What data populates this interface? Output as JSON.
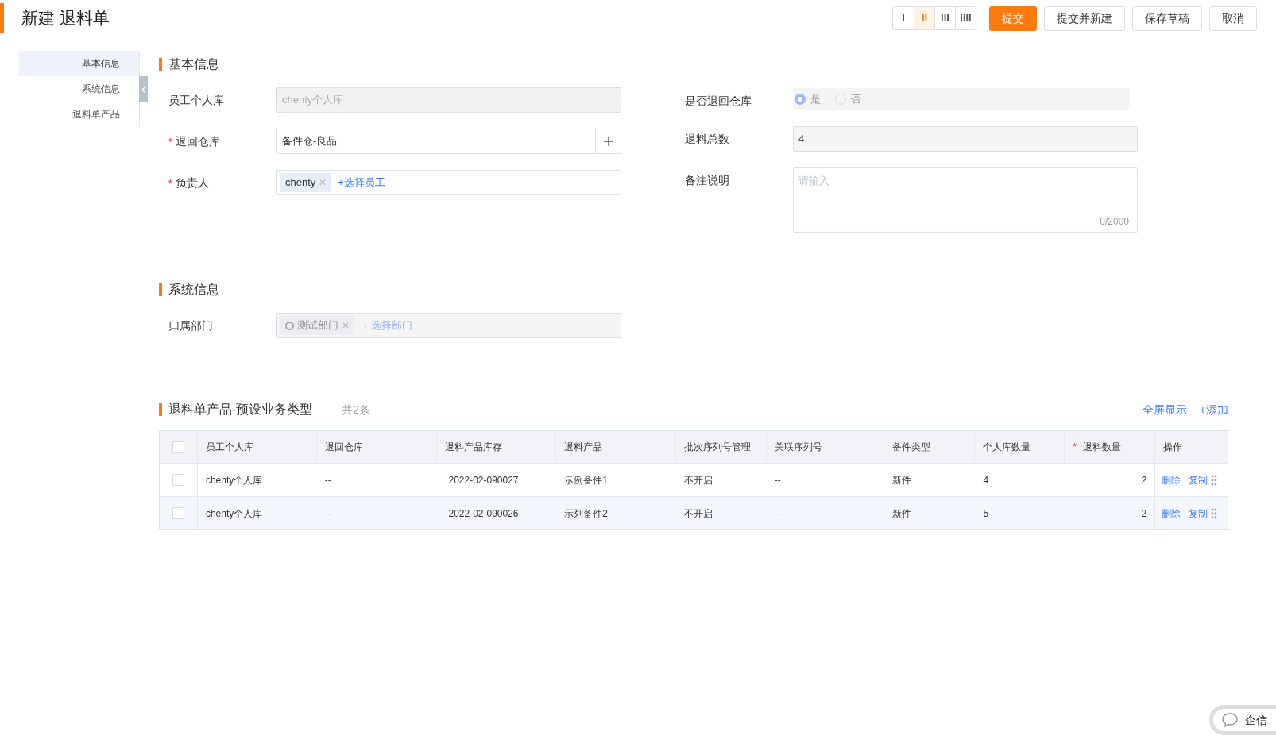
{
  "header": {
    "title": "新建 退料单",
    "layout_options": [
      {
        "label": "I",
        "selected": false
      },
      {
        "label": "II",
        "selected": true
      },
      {
        "label": "III",
        "selected": false
      },
      {
        "label": "IIII",
        "selected": false
      }
    ],
    "buttons": [
      {
        "label": "提交",
        "kind": "primary"
      },
      {
        "label": "提交并新建",
        "kind": "default"
      },
      {
        "label": "保存草稿",
        "kind": "default"
      },
      {
        "label": "取消",
        "kind": "default"
      }
    ]
  },
  "nav": [
    {
      "label": "基本信息",
      "selected": true
    },
    {
      "label": "系统信息",
      "selected": false
    },
    {
      "label": "退料单产品",
      "selected": false
    }
  ],
  "basic": {
    "title": "基本信息",
    "left": [
      {
        "label": "员工个人库",
        "kind": "readonly",
        "value": "chenty个人库"
      },
      {
        "label": "退回仓库",
        "required_mark": "*",
        "kind": "select-add",
        "value": "备件仓-良品"
      },
      {
        "label": "负责人",
        "required_mark": "*",
        "kind": "tags",
        "tags": [
          {
            "text": "chenty",
            "remove": "✕"
          }
        ],
        "link": "+选择员工"
      }
    ],
    "right": [
      {
        "label": "是否退回仓库",
        "kind": "radio",
        "options": [
          {
            "label": "是",
            "selected": true
          },
          {
            "label": "否",
            "selected": false
          }
        ]
      },
      {
        "label": "退料总数",
        "kind": "readonly-dark",
        "value": "4"
      },
      {
        "label": "备注说明",
        "kind": "textarea",
        "placeholder": "请输入",
        "counter": "0/2000"
      }
    ]
  },
  "system": {
    "title": "系统信息",
    "fields": [
      {
        "label": "归属部门",
        "tags": [
          {
            "text": "测试部门",
            "remove": "✕"
          }
        ],
        "link": "+ 选择部门"
      }
    ]
  },
  "products": {
    "title": "退料单产品-预设业务类型",
    "count": "共2条",
    "actions": [
      "全屏显示",
      "+添加"
    ],
    "select_all": {
      "checked": false
    },
    "columns": [
      {
        "label": "员工个人库"
      },
      {
        "label": "退回仓库"
      },
      {
        "label": "退料产品库存"
      },
      {
        "label": "退料产品"
      },
      {
        "label": "批次序列号管理"
      },
      {
        "label": "关联序列号"
      },
      {
        "label": "备件类型"
      },
      {
        "label": "个人库数量"
      },
      {
        "label": "退料数量",
        "required_mark": "*"
      },
      {
        "label": "操作"
      }
    ],
    "rows": [
      {
        "checked": false,
        "cells": [
          "chenty个人库",
          "--",
          "2022-02-090027",
          "示例备件1",
          "不开启",
          "--",
          "新件",
          "4",
          "2"
        ],
        "ops": [
          "删除",
          "复制"
        ]
      },
      {
        "checked": false,
        "cells": [
          "chenty个人库",
          "--",
          "2022-02-090026",
          "示列备件2",
          "不开启",
          "--",
          "新件",
          "5",
          "2"
        ],
        "ops": [
          "删除",
          "复制"
        ]
      }
    ]
  },
  "chat": {
    "label": "企信"
  }
}
